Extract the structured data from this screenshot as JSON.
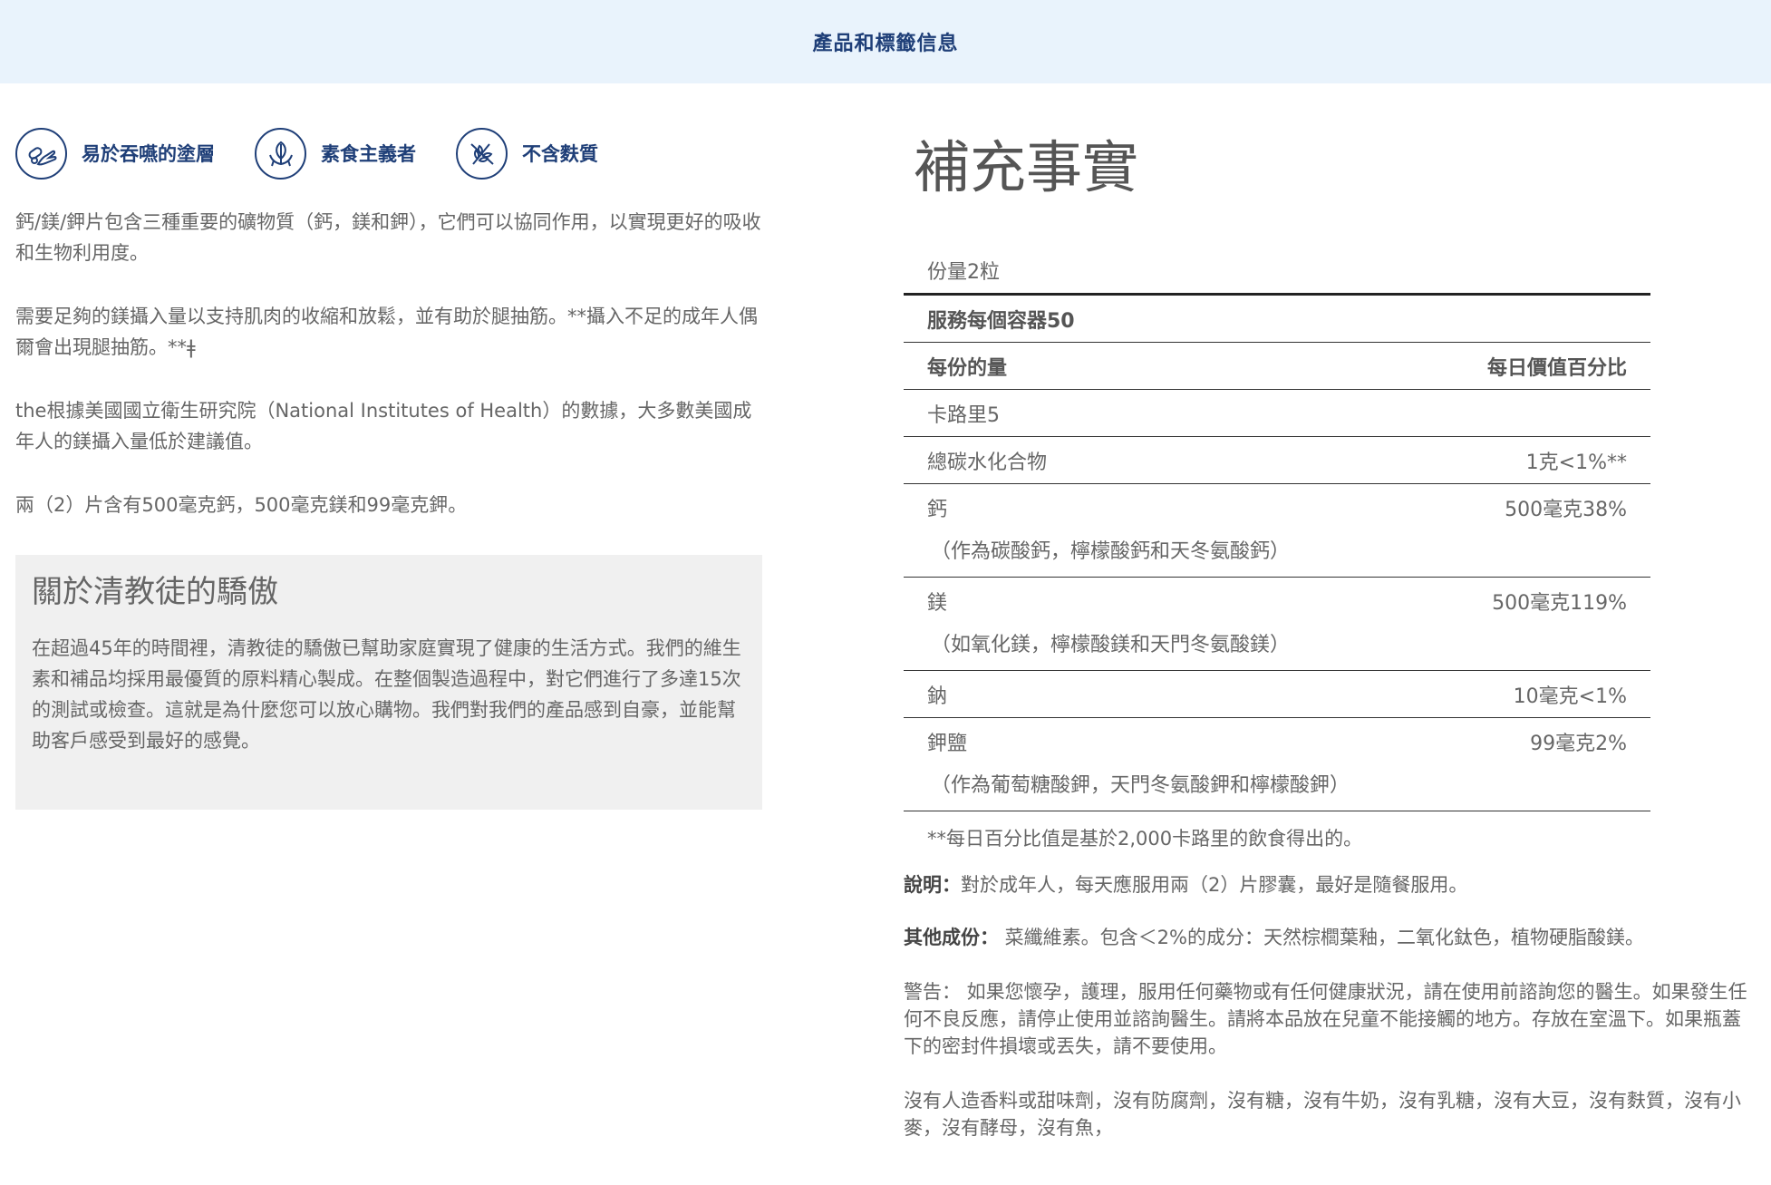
{
  "banner": {
    "title": "產品和標籤信息"
  },
  "badges": [
    {
      "icon": "capsule-hand-icon",
      "label": "易於吞嚥的塗層"
    },
    {
      "icon": "vegan-leaf-icon",
      "label": "素食主義者"
    },
    {
      "icon": "gluten-free-wheat-icon",
      "label": "不含麩質"
    }
  ],
  "description": {
    "p1": "鈣/鎂/鉀片包含三種重要的礦物質（鈣，鎂和鉀），它們可以協同作用，以實現更好的吸收和生物利用度。",
    "p2": "需要足夠的鎂攝入量以支持肌肉的收縮和放鬆，並有助於腿抽筋。**攝入不足的成年人偶爾會出現腿抽筋。**ǂ",
    "p3": "the根據美國國立衛生研究院（National Institutes of Health）的數據，大多數美國成年人的鎂攝入量低於建議值。",
    "p4": "兩（2）片含有500毫克鈣，500毫克鎂和99毫克鉀。"
  },
  "about": {
    "title": "關於清教徒的驕傲",
    "body": "在超過45年的時間裡，清教徒的驕傲已幫助家庭實現了健康的生活方式。我們的維生素和補品均採用最優質的原料精心製成。在整個製造過程中，對它們進行了多達15次的測試或檢查。這就是為什麼您可以放心購物。我們對我們的產品感到自豪，並能幫助客戶感受到最好的感覺。"
  },
  "supplement_facts": {
    "title": "補充事實",
    "serving_size": "份量2粒",
    "servings_per_container": "服務每個容器50",
    "header_amount": "每份的量",
    "header_dv": "每日價值百分比",
    "calories": "卡路里5",
    "carbs": {
      "name": "總碳水化合物",
      "value": "1克<1%**"
    },
    "calcium": {
      "name": "鈣",
      "value": "500毫克38%",
      "sub": "（作為碳酸鈣，檸檬酸鈣和天冬氨酸鈣）"
    },
    "magnesium": {
      "name": "鎂",
      "value": "500毫克119%",
      "sub": "（如氧化鎂，檸檬酸鎂和天門冬氨酸鎂）"
    },
    "sodium": {
      "name": "鈉",
      "value": "10毫克<1%"
    },
    "potassium": {
      "name": "鉀鹽",
      "value": "99毫克2%",
      "sub": "（作為葡萄糖酸鉀，天門冬氨酸鉀和檸檬酸鉀）"
    },
    "footnote": "**每日百分比值是基於2,000卡路里的飲食得出的。"
  },
  "info": {
    "directions_label": "說明：",
    "directions_text": "對於成年人，每天應服用兩（2）片膠囊，最好是隨餐服用。",
    "other_label": "其他成份：",
    "other_text": " 菜纖維素。包含＜2%的成分：天然棕櫚葉釉，二氧化鈦色，植物硬脂酸鎂。",
    "warning": "警告： 如果您懷孕，護理，服用任何藥物或有任何健康狀況，請在使用前諮詢您的醫生。如果發生任何不良反應，請停止使用並諮詢醫生。請將本品放在兒童不能接觸的地方。存放在室溫下。如果瓶蓋下的密封件損壞或丟失，請不要使用。",
    "free_from": "沒有人造香料或甜味劑，沒有防腐劑，沒有糖，沒有牛奶，沒有乳糖，沒有大豆，沒有麩質，沒有小麥，沒有酵母，沒有魚，"
  },
  "colors": {
    "brand": "#1f3f78",
    "banner_bg": "#e9f3fc",
    "panel_bg": "#f0f0f0"
  }
}
